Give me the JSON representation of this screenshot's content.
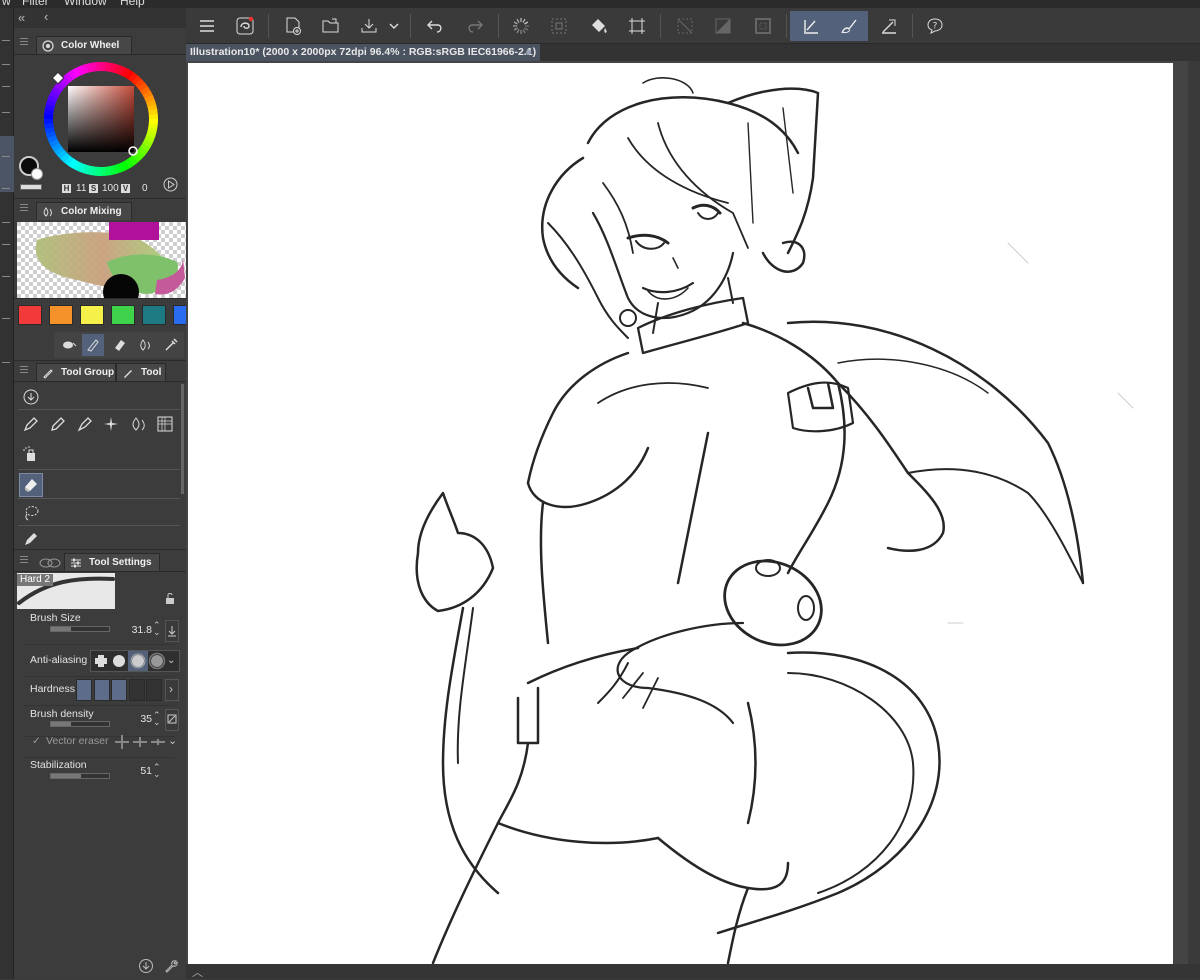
{
  "menu": {
    "items": [
      "Filter",
      "Window",
      "Help"
    ]
  },
  "color_wheel": {
    "title": "Color Wheel",
    "h_label": "H",
    "h_value": "11",
    "s_label": "S",
    "s_value": "100",
    "v_label": "V",
    "v_value": "0",
    "hue_color": "#c44b3a"
  },
  "color_mixing": {
    "title": "Color Mixing"
  },
  "palette": {
    "colors": [
      "#f23a3a",
      "#f5922a",
      "#f5f04a",
      "#3ed34a",
      "#1e7a82",
      "#2a6cf0"
    ]
  },
  "tool_panel": {
    "tab_group": "Tool Group",
    "tab_tool": "Tool"
  },
  "tool_settings": {
    "title": "Tool Settings",
    "brush_name": "Hard 2",
    "brush_size_label": "Brush Size",
    "brush_size_value": "31.8",
    "brush_size_level": 0.35,
    "anti_aliasing_label": "Anti-aliasing",
    "hardness_label": "Hardness",
    "hardness_level": 3,
    "hardness_steps": 5,
    "brush_density_label": "Brush density",
    "brush_density_value": "35",
    "brush_density_level": 0.35,
    "vector_eraser_label": "Vector eraser",
    "stabilization_label": "Stabilization",
    "stabilization_value": "51",
    "stabilization_level": 0.51
  },
  "document": {
    "tab_title": "Illustration10* (2000 x 2000px 72dpi 96.4% : RGB:sRGB IEC61966-2.1)"
  },
  "icons": [
    "menu-icon",
    "app-logo-icon",
    "new-canvas-icon",
    "open-folder-icon",
    "save-icon",
    "undo-icon",
    "redo-icon",
    "loading-icon",
    "select-all-icon",
    "fill-icon",
    "transform-icon",
    "clear-icon",
    "tone-icon",
    "border-icon",
    "pen-pressure-icon",
    "brush-stroke-icon",
    "ruler-icon",
    "help-icon"
  ],
  "colors": {
    "accent_selected": "#53627a",
    "panel_bg": "#3c3c3c",
    "canvas_bg": "#ffffff"
  }
}
